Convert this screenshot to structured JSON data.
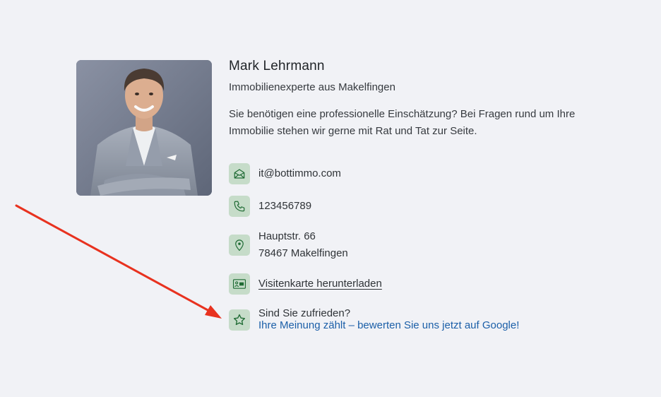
{
  "agent": {
    "name": "Mark Lehrmann",
    "role": "Immobilienexperte aus Makelfingen",
    "description_line1": "Sie benötigen eine professionelle Einschätzung? Bei Fragen rund um Ihre",
    "description_line2": "Immobilie stehen wir gerne mit Rat und Tat zur Seite."
  },
  "contact": {
    "email": "it@bottimmo.com",
    "phone": "123456789",
    "address_line1": "Hauptstr. 66",
    "address_line2": "78467 Makelfingen",
    "vcard_label": "Visitenkarte herunterladen",
    "review_question": "Sind Sie zufrieden?",
    "review_link": "Ihre Meinung zählt – bewerten Sie uns jetzt auf Google!"
  },
  "icons": {
    "email": "envelope-icon",
    "phone": "phone-icon",
    "address": "map-pin-icon",
    "vcard": "id-card-icon",
    "review": "star-icon"
  },
  "colors": {
    "background": "#f1f2f6",
    "icon_bg": "#c6dcc9",
    "icon_stroke": "#1f6b34",
    "link": "#1b5fa8",
    "annotation_arrow": "#e8321f"
  }
}
